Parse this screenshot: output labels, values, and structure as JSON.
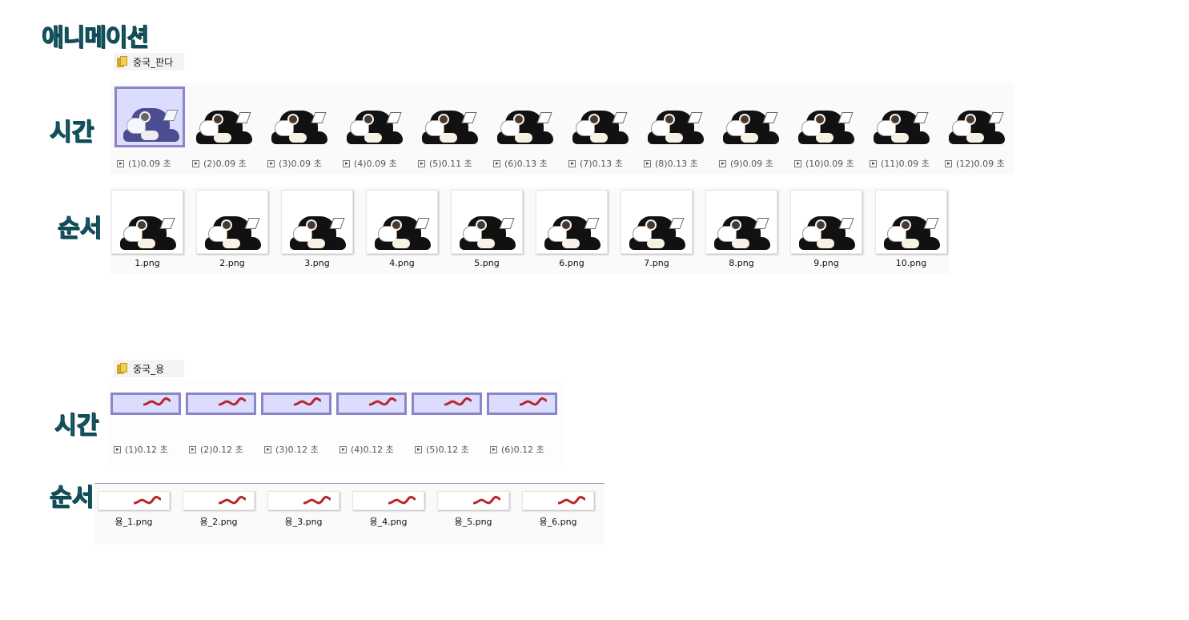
{
  "title": "애니메이션",
  "panda": {
    "folder": "중국_판다",
    "side_time": "시간",
    "side_order": "순서",
    "frames": [
      {
        "idx": "(1)",
        "time": "0.09 초"
      },
      {
        "idx": "(2)",
        "time": "0.09 초"
      },
      {
        "idx": "(3)",
        "time": "0.09 초"
      },
      {
        "idx": "(4)",
        "time": "0.09 초"
      },
      {
        "idx": "(5)",
        "time": "0.11 초"
      },
      {
        "idx": "(6)",
        "time": "0.13 초"
      },
      {
        "idx": "(7)",
        "time": "0.13 초"
      },
      {
        "idx": "(8)",
        "time": "0.13 초"
      },
      {
        "idx": "(9)",
        "time": "0.09 초"
      },
      {
        "idx": "(10)",
        "time": "0.09 초"
      },
      {
        "idx": "(11)",
        "time": "0.09 초"
      },
      {
        "idx": "(12)",
        "time": "0.09 초"
      }
    ],
    "files": [
      "1.png",
      "2.png",
      "3.png",
      "4.png",
      "5.png",
      "6.png",
      "7.png",
      "8.png",
      "9.png",
      "10.png"
    ]
  },
  "dragon": {
    "folder": "중국_용",
    "side_time": "시간",
    "side_order": "순서",
    "frames": [
      {
        "idx": "(1)",
        "time": "0.12 초"
      },
      {
        "idx": "(2)",
        "time": "0.12 초"
      },
      {
        "idx": "(3)",
        "time": "0.12 초"
      },
      {
        "idx": "(4)",
        "time": "0.12 초"
      },
      {
        "idx": "(5)",
        "time": "0.12 초"
      },
      {
        "idx": "(6)",
        "time": "0.12 초"
      }
    ],
    "files": [
      "용_1.png",
      "용_2.png",
      "용_3.png",
      "용_4.png",
      "용_5.png",
      "용_6.png"
    ]
  },
  "colors": {
    "handwriting": "#2d7f8a",
    "selection": "#dcdcff",
    "selection_border": "#8a86c7",
    "dragon": "#b8262a"
  }
}
